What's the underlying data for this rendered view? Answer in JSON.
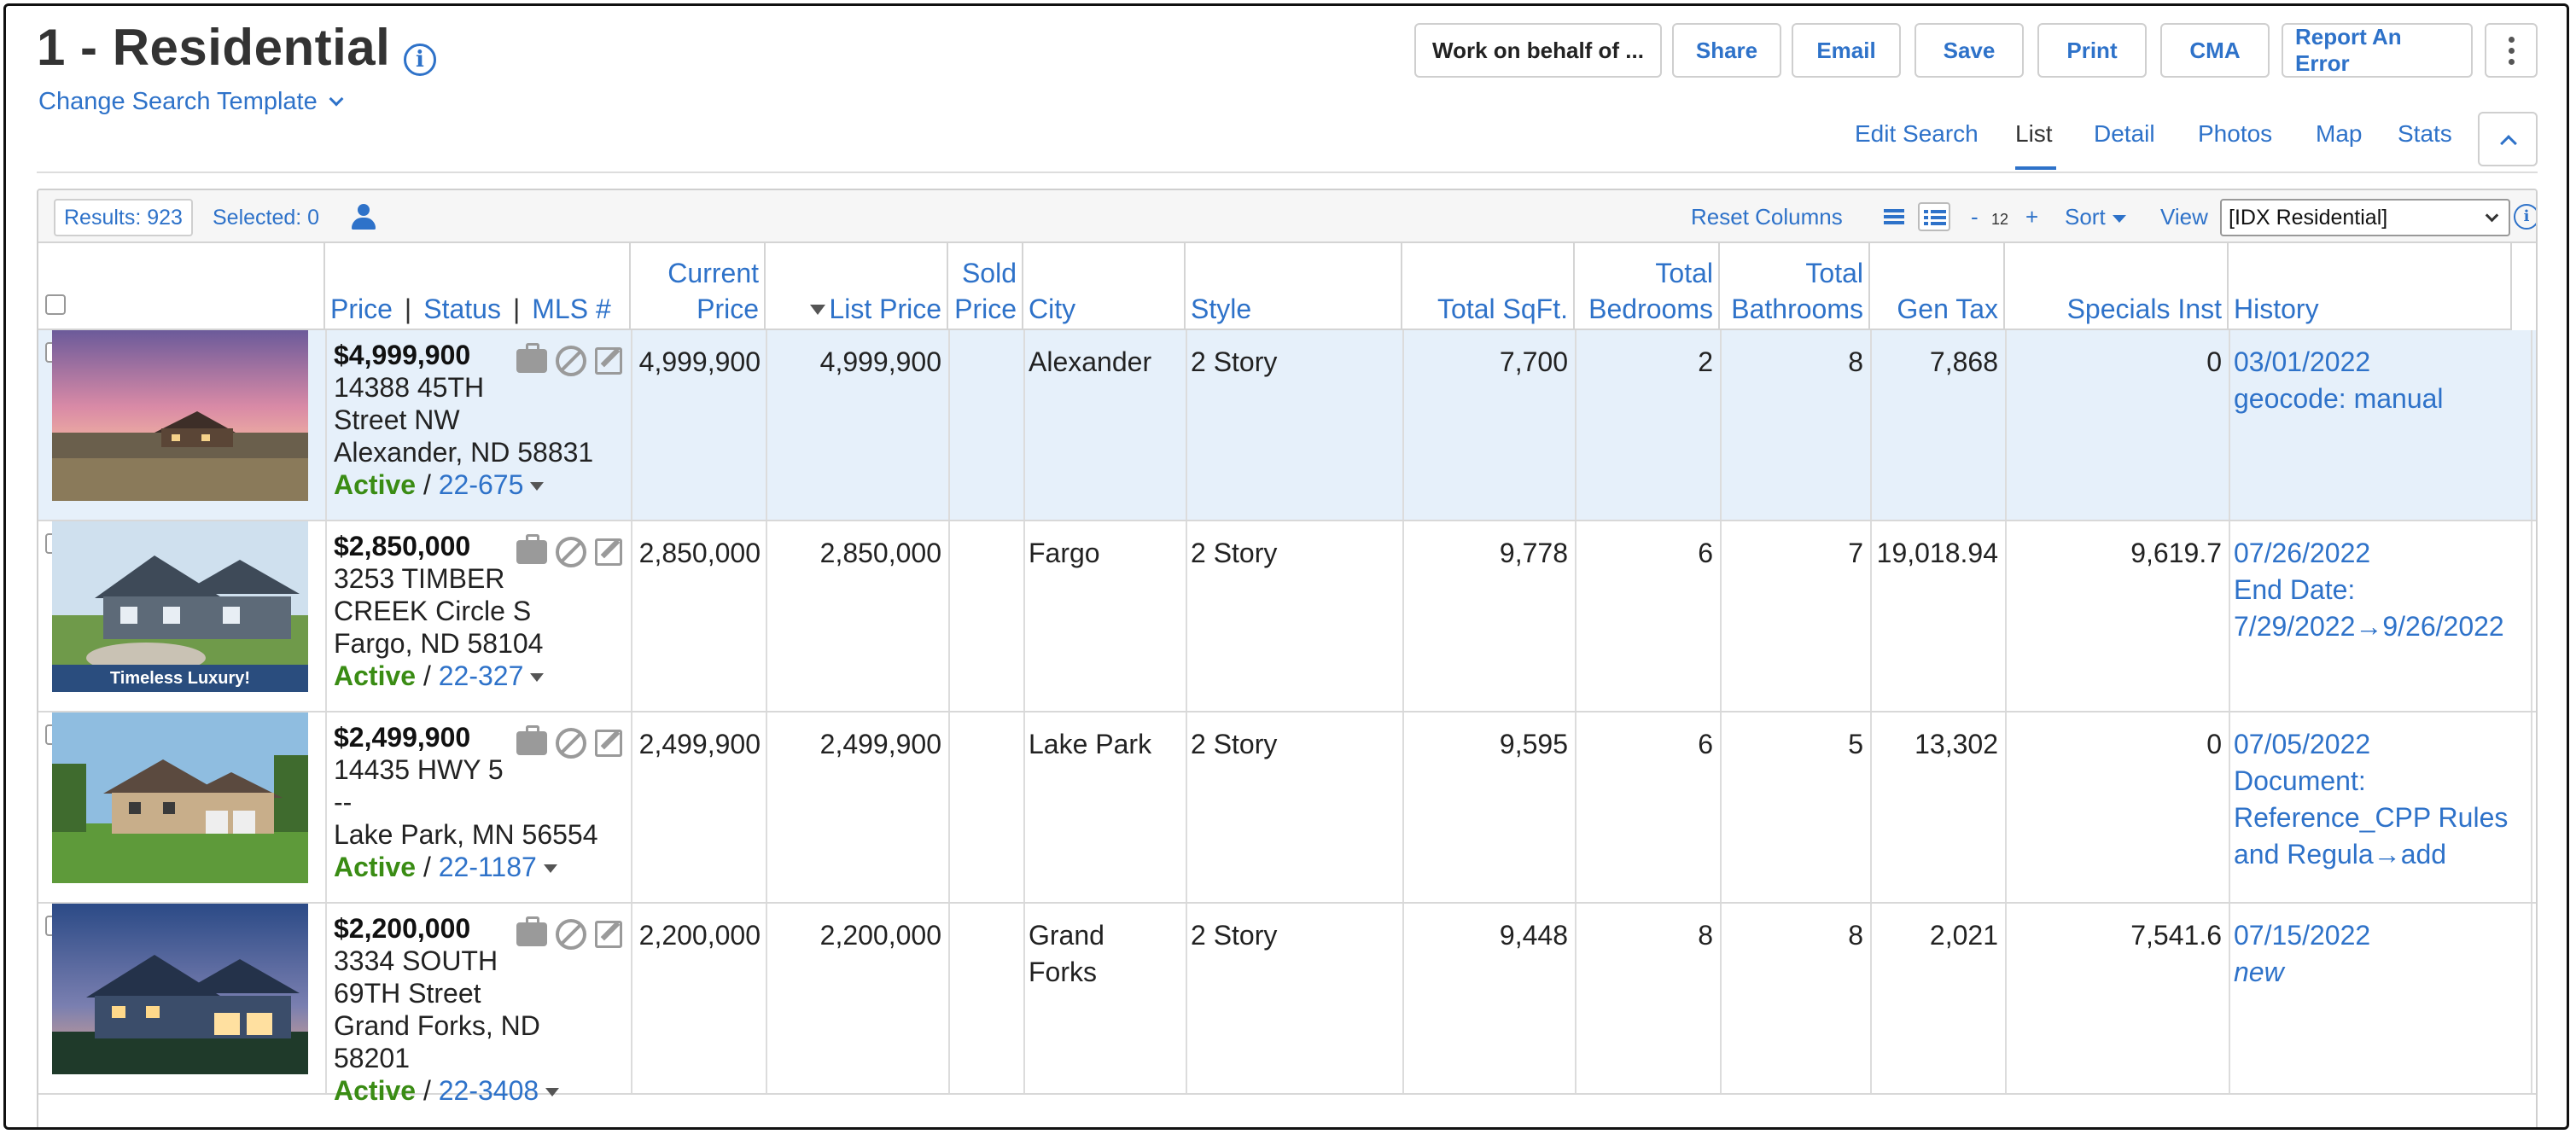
{
  "page": {
    "title": "1 - Residential",
    "change_template": "Change Search Template"
  },
  "header_buttons": {
    "work_on_behalf": "Work on behalf of ...",
    "share": "Share",
    "email": "Email",
    "save": "Save",
    "print": "Print",
    "cma": "CMA",
    "report_error": "Report An Error"
  },
  "tabs": [
    "Edit Search",
    "List",
    "Detail",
    "Photos",
    "Map",
    "Stats"
  ],
  "active_tab": "List",
  "toolbar": {
    "results": "Results: 923",
    "selected": "Selected: 0",
    "reset_columns": "Reset Columns",
    "zoom_minus": "-",
    "zoom_value": "12",
    "zoom_plus": "+",
    "sort": "Sort",
    "view_label": "View",
    "view_value": "[IDX Residential]"
  },
  "columns": {
    "price": "Price",
    "status": "Status",
    "mls": "MLS #",
    "current_price_1": "Current",
    "current_price_2": "Price",
    "list_price": "List Price",
    "sold_price_1": "Sold",
    "sold_price_2": "Price",
    "city": "City",
    "style": "Style",
    "total_sqft": "Total SqFt.",
    "bedrooms_1": "Total",
    "bedrooms_2": "Bedrooms",
    "bathrooms_1": "Total",
    "bathrooms_2": "Bathrooms",
    "gen_tax": "Gen Tax",
    "specials_inst": "Specials Inst",
    "history": "History"
  },
  "listings": [
    {
      "num": "1",
      "price": "$4,999,900",
      "addr1": "14388 45TH",
      "addr2": "Street NW",
      "addr3": "Alexander, ND 58831",
      "addr4": "",
      "status": "Active",
      "mls": "22-675",
      "current_price": "4,999,900",
      "list_price": "4,999,900",
      "sold_price": "",
      "city1": "Alexander",
      "city2": "",
      "style": "2 Story",
      "sqft": "7,700",
      "bedrooms": "2",
      "bathrooms": "8",
      "gen_tax": "7,868",
      "specials": "0",
      "hist1": "03/01/2022",
      "hist2": "geocode: manual",
      "hist3": "",
      "hist4": "",
      "image_tag": ""
    },
    {
      "num": "2",
      "price": "$2,850,000",
      "addr1": "3253 TIMBER",
      "addr2": "CREEK Circle S",
      "addr3": "Fargo, ND 58104",
      "addr4": "",
      "status": "Active",
      "mls": "22-327",
      "current_price": "2,850,000",
      "list_price": "2,850,000",
      "sold_price": "",
      "city1": "Fargo",
      "city2": "",
      "style": "2 Story",
      "sqft": "9,778",
      "bedrooms": "6",
      "bathrooms": "7",
      "gen_tax": "19,018.94",
      "specials": "9,619.7",
      "hist1": "07/26/2022",
      "hist2": "End Date:",
      "hist3": "7/29/2022→9/26/2022",
      "hist4": "",
      "image_tag": "Timeless Luxury!"
    },
    {
      "num": "3",
      "price": "$2,499,900",
      "addr1": "14435 HWY 5",
      "addr2": "--",
      "addr3": "Lake Park, MN 56554",
      "addr4": "",
      "status": "Active",
      "mls": "22-1187",
      "current_price": "2,499,900",
      "list_price": "2,499,900",
      "sold_price": "",
      "city1": "Lake Park",
      "city2": "",
      "style": "2 Story",
      "sqft": "9,595",
      "bedrooms": "6",
      "bathrooms": "5",
      "gen_tax": "13,302",
      "specials": "0",
      "hist1": "07/05/2022",
      "hist2": "Document:",
      "hist3": "Reference_CPP Rules",
      "hist4": "and Regula→add",
      "image_tag": ""
    },
    {
      "num": "4",
      "price": "$2,200,000",
      "addr1": "3334 SOUTH",
      "addr2": "69TH Street",
      "addr3": "Grand Forks, ND",
      "addr4": "58201",
      "status": "Active",
      "mls": "22-3408",
      "current_price": "2,200,000",
      "list_price": "2,200,000",
      "sold_price": "",
      "city1": "Grand",
      "city2": "Forks",
      "style": "2 Story",
      "sqft": "9,448",
      "bedrooms": "8",
      "bathrooms": "8",
      "gen_tax": "2,021",
      "specials": "7,541.6",
      "hist1": "07/15/2022",
      "hist2": "new",
      "hist3": "",
      "hist4": "",
      "image_tag": ""
    }
  ],
  "colors": {
    "link": "#2e72c9",
    "active_status": "#3a8c14",
    "selected_row": "#e6f0fa"
  },
  "icons": [
    "info-icon",
    "chevron-down-icon",
    "more-vertical-icon",
    "chevron-up-icon",
    "user-icon",
    "list-view-icon",
    "detail-list-icon",
    "sort-caret-icon",
    "briefcase-icon",
    "block-icon",
    "edit-icon"
  ]
}
